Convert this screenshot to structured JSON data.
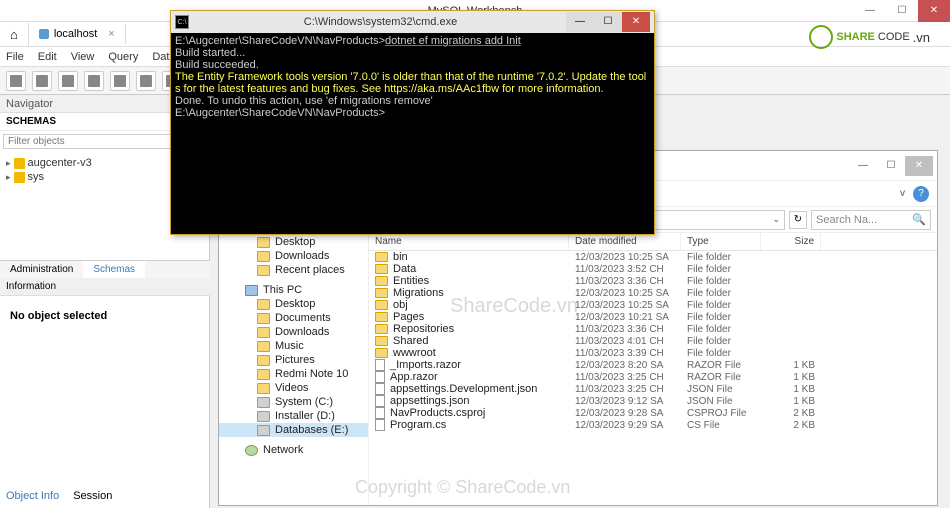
{
  "workbench": {
    "title": "MySQL Workbench",
    "tab": "localhost",
    "menu": [
      "File",
      "Edit",
      "View",
      "Query",
      "Database"
    ],
    "nav_header": "Navigator",
    "schemas_header": "SCHEMAS",
    "filter_placeholder": "Filter objects",
    "schemas": [
      "augcenter-v3",
      "sys"
    ],
    "admin_tab": "Administration",
    "schemas_tab": "Schemas",
    "info_header": "Information",
    "no_object": "No object selected",
    "bottom_tabs": [
      "Object Info",
      "Session"
    ]
  },
  "explorer": {
    "search_placeholder": "Search Na...",
    "dropdown_chevron": "v",
    "columns": {
      "name": "Name",
      "date": "Date modified",
      "type": "Type",
      "size": "Size"
    },
    "nav": [
      {
        "label": "Desktop",
        "lvl": 1,
        "icon": "folder"
      },
      {
        "label": "Downloads",
        "lvl": 1,
        "icon": "folder"
      },
      {
        "label": "Recent places",
        "lvl": 1,
        "icon": "folder"
      },
      {
        "label": "",
        "lvl": 1,
        "icon": "",
        "spacer": true
      },
      {
        "label": "This PC",
        "lvl": 0,
        "icon": "pc"
      },
      {
        "label": "Desktop",
        "lvl": 1,
        "icon": "folder"
      },
      {
        "label": "Documents",
        "lvl": 1,
        "icon": "folder"
      },
      {
        "label": "Downloads",
        "lvl": 1,
        "icon": "folder"
      },
      {
        "label": "Music",
        "lvl": 1,
        "icon": "folder"
      },
      {
        "label": "Pictures",
        "lvl": 1,
        "icon": "folder"
      },
      {
        "label": "Redmi Note 10",
        "lvl": 1,
        "icon": "folder"
      },
      {
        "label": "Videos",
        "lvl": 1,
        "icon": "folder"
      },
      {
        "label": "System (C:)",
        "lvl": 1,
        "icon": "drive"
      },
      {
        "label": "Installer (D:)",
        "lvl": 1,
        "icon": "drive"
      },
      {
        "label": "Databases (E:)",
        "lvl": 1,
        "icon": "drive",
        "sel": true
      },
      {
        "label": "",
        "lvl": 1,
        "icon": "",
        "spacer": true
      },
      {
        "label": "Network",
        "lvl": 0,
        "icon": "net"
      }
    ],
    "files": [
      {
        "name": "bin",
        "date": "12/03/2023 10:25 SA",
        "type": "File folder",
        "size": "",
        "folder": true
      },
      {
        "name": "Data",
        "date": "11/03/2023 3:52 CH",
        "type": "File folder",
        "size": "",
        "folder": true
      },
      {
        "name": "Entities",
        "date": "11/03/2023 3:36 CH",
        "type": "File folder",
        "size": "",
        "folder": true
      },
      {
        "name": "Migrations",
        "date": "12/03/2023 10:25 SA",
        "type": "File folder",
        "size": "",
        "folder": true
      },
      {
        "name": "obj",
        "date": "12/03/2023 10:25 SA",
        "type": "File folder",
        "size": "",
        "folder": true
      },
      {
        "name": "Pages",
        "date": "12/03/2023 10:21 SA",
        "type": "File folder",
        "size": "",
        "folder": true
      },
      {
        "name": "Repositories",
        "date": "11/03/2023 3:36 CH",
        "type": "File folder",
        "size": "",
        "folder": true
      },
      {
        "name": "Shared",
        "date": "11/03/2023 4:01 CH",
        "type": "File folder",
        "size": "",
        "folder": true
      },
      {
        "name": "wwwroot",
        "date": "11/03/2023 3:39 CH",
        "type": "File folder",
        "size": "",
        "folder": true
      },
      {
        "name": "_Imports.razor",
        "date": "12/03/2023 8:20 SA",
        "type": "RAZOR File",
        "size": "1 KB",
        "folder": false
      },
      {
        "name": "App.razor",
        "date": "11/03/2023 3:25 CH",
        "type": "RAZOR File",
        "size": "1 KB",
        "folder": false
      },
      {
        "name": "appsettings.Development.json",
        "date": "11/03/2023 3:25 CH",
        "type": "JSON File",
        "size": "1 KB",
        "folder": false
      },
      {
        "name": "appsettings.json",
        "date": "12/03/2023 9:12 SA",
        "type": "JSON File",
        "size": "1 KB",
        "folder": false
      },
      {
        "name": "NavProducts.csproj",
        "date": "12/03/2023 9:28 SA",
        "type": "CSPROJ File",
        "size": "2 KB",
        "folder": false
      },
      {
        "name": "Program.cs",
        "date": "12/03/2023 9:29 SA",
        "type": "CS File",
        "size": "2 KB",
        "folder": false
      }
    ]
  },
  "cmd": {
    "title": "C:\\Windows\\system32\\cmd.exe",
    "icon_text": "C:\\",
    "lines": [
      {
        "cls": "",
        "text": "E:\\Augcenter\\ShareCodeVN\\NavProducts>",
        "suffix": "dotnet ef migrations add Init",
        "underline": true
      },
      {
        "cls": "",
        "text": "Build started..."
      },
      {
        "cls": "",
        "text": "Build succeeded."
      },
      {
        "cls": "cmd-yellow",
        "text": "The Entity Framework tools version '7.0.0' is older than that of the runtime '7.0.2'. Update the tools for the latest features and bug fixes. See https://aka.ms/AAc1fbw for more information."
      },
      {
        "cls": "",
        "text": "Done. To undo this action, use 'ef migrations remove'"
      },
      {
        "cls": "",
        "text": ""
      },
      {
        "cls": "",
        "text": "E:\\Augcenter\\ShareCodeVN\\NavProducts>"
      }
    ]
  },
  "watermark": {
    "logo1": "SHARE",
    "logo2": "CODE",
    "logo3": ".vn",
    "center": "ShareCode.vn",
    "copyright": "Copyright © ShareCode.vn"
  }
}
